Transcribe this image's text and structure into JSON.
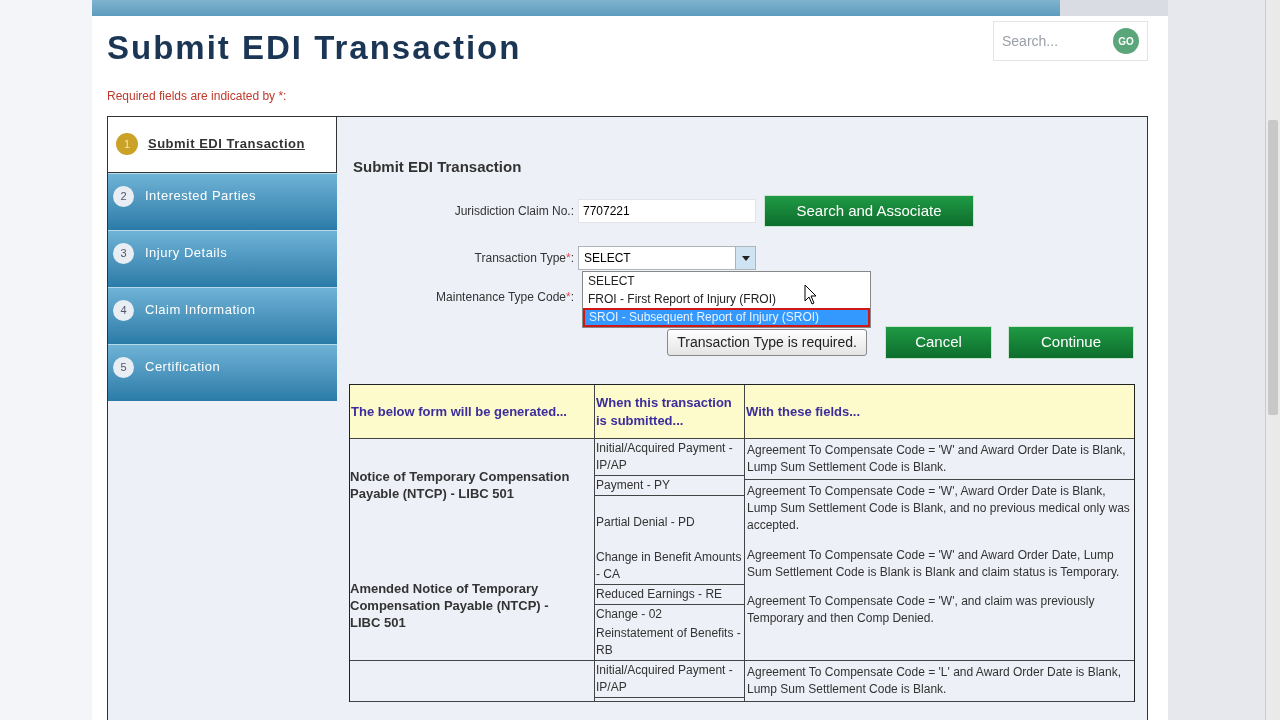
{
  "header": {
    "title": "Submit EDI Transaction",
    "required_note": "Required fields are indicated by *:",
    "search": {
      "placeholder": "Search...",
      "button": "GO"
    }
  },
  "steps": [
    {
      "number": "1",
      "label": "Submit EDI Transaction",
      "selected": true
    },
    {
      "number": "2",
      "label": "Interested Parties",
      "selected": false
    },
    {
      "number": "3",
      "label": "Injury Details",
      "selected": false
    },
    {
      "number": "4",
      "label": "Claim Information",
      "selected": false
    },
    {
      "number": "5",
      "label": "Certification",
      "selected": false
    }
  ],
  "form": {
    "title": "Submit EDI Transaction",
    "claim_no": {
      "label": "Jurisdiction Claim No.:",
      "value": "7707221"
    },
    "search_button": "Search and Associate",
    "transaction_type": {
      "label": "Transaction Type",
      "required_mark": "*",
      "suffix": ":",
      "value": "SELECT",
      "expanded": true,
      "options": [
        {
          "label": "SELECT",
          "highlighted": false
        },
        {
          "label": "FROI - First Report of Injury (FROI)",
          "highlighted": false
        },
        {
          "label": "SROI - Subsequent Report of Injury (SROI)",
          "highlighted": true
        }
      ]
    },
    "maintenance_type_code": {
      "label": "Maintenance Type Code",
      "required_mark": "*",
      "suffix": ":"
    },
    "tooltip": "Transaction Type is required.",
    "buttons": [
      "Cancel",
      "Continue"
    ]
  },
  "table": {
    "columns": [
      "The below form will be generated...",
      "When this transaction is submitted...",
      "With these fields..."
    ],
    "groups": [
      {
        "forms": [
          "Notice of Temporary Compensation Payable (NTCP) - LIBC 501",
          "Amended Notice of Temporary Compensation Payable (NTCP) - LIBC 501"
        ],
        "transactions": [
          {
            "text": "Initial/Acquired Payment - IP/AP",
            "rule_below": true
          },
          {
            "text": "Payment - PY",
            "rule_below": true
          },
          {
            "text": "Partial Denial - PD",
            "rule_below": false
          },
          {
            "text": "Change in Benefit Amounts - CA",
            "rule_below": true
          },
          {
            "text": "Reduced Earnings - RE",
            "rule_below": true
          },
          {
            "text": "Change - 02",
            "rule_below": false
          },
          {
            "text": "Reinstatement of Benefits - RB",
            "rule_below": false
          }
        ],
        "fields": [
          {
            "text": "Agreement To Compensate Code = 'W' and Award Order Date is Blank, Lump Sum Settlement Code is Blank.",
            "rule_below": true
          },
          {
            "text": "Agreement To Compensate Code = 'W', Award Order Date is Blank, Lump Sum Settlement Code is Blank, and no previous medical only was accepted.",
            "rule_below": false
          },
          {
            "text": "Agreement To Compensate Code = 'W' and Award Order Date, Lump Sum Settlement Code is Blank is Blank and claim status is Temporary.",
            "rule_below": false
          },
          {
            "text": "Agreement To Compensate Code = 'W', and claim was previously Temporary and then Comp Denied.",
            "rule_below": false
          }
        ]
      },
      {
        "transactions": [
          {
            "text": "Initial/Acquired Payment - IP/AP",
            "rule_below": true
          }
        ],
        "fields": [
          {
            "text": "Agreement To Compensate Code = 'L' and Award Order Date is Blank, Lump Sum Settlement Code is Blank.",
            "rule_below": false
          }
        ]
      }
    ]
  }
}
